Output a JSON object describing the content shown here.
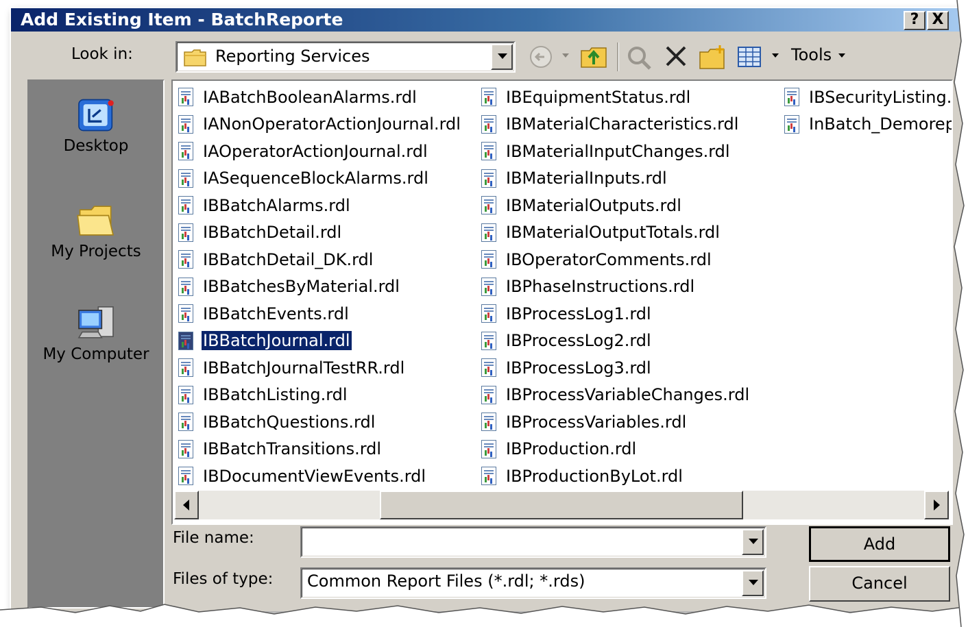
{
  "window": {
    "title": "Add Existing Item - BatchReporte",
    "help_button": "?",
    "close_button": "X"
  },
  "look_in": {
    "label": "Look in:",
    "value": "Reporting Services"
  },
  "toolbar": {
    "tools_label": "Tools"
  },
  "places_bar": [
    {
      "label": "Desktop",
      "icon": "desktop-icon"
    },
    {
      "label": "My Projects",
      "icon": "folder-icon"
    },
    {
      "label": "My Computer",
      "icon": "computer-icon"
    }
  ],
  "files": {
    "column1": [
      "IABatchBooleanAlarms.rdl",
      "IANonOperatorActionJournal.rdl",
      "IAOperatorActionJournal.rdl",
      "IASequenceBlockAlarms.rdl",
      "IBBatchAlarms.rdl",
      "IBBatchDetail.rdl",
      "IBBatchDetail_DK.rdl",
      "IBBatchesByMaterial.rdl",
      "IBBatchEvents.rdl",
      "IBBatchJournal.rdl",
      "IBBatchJournalTestRR.rdl",
      "IBBatchListing.rdl",
      "IBBatchQuestions.rdl",
      "IBBatchTransitions.rdl",
      "IBDocumentViewEvents.rdl"
    ],
    "column2": [
      "IBEquipmentStatus.rdl",
      "IBMaterialCharacteristics.rdl",
      "IBMaterialInputChanges.rdl",
      "IBMaterialInputs.rdl",
      "IBMaterialOutputs.rdl",
      "IBMaterialOutputTotals.rdl",
      "IBOperatorComments.rdl",
      "IBPhaseInstructions.rdl",
      "IBProcessLog1.rdl",
      "IBProcessLog2.rdl",
      "IBProcessLog3.rdl",
      "IBProcessVariableChanges.rdl",
      "IBProcessVariables.rdl",
      "IBProduction.rdl",
      "IBProductionByLot.rdl"
    ],
    "column3": [
      "IBSecurityListing.r",
      "InBatch_Demorep"
    ],
    "selected": "IBBatchJournal.rdl"
  },
  "file_name": {
    "label": "File name:",
    "value": ""
  },
  "files_of_type": {
    "label": "Files of type:",
    "value": "Common Report Files (*.rdl; *.rds)"
  },
  "buttons": {
    "add": "Add",
    "cancel": "Cancel"
  }
}
